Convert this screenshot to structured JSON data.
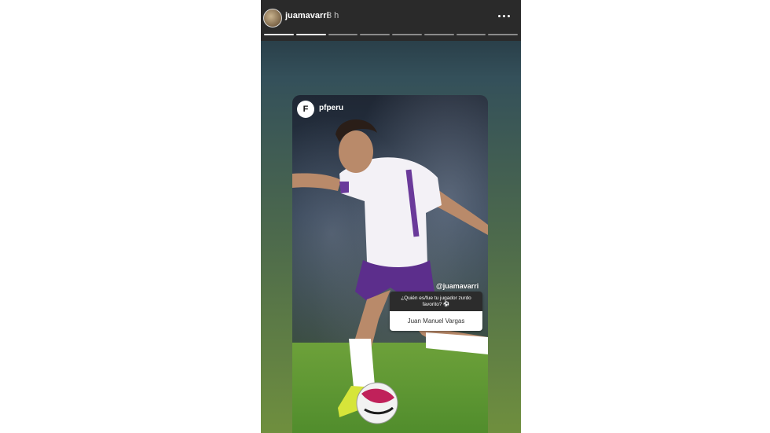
{
  "story": {
    "username": "juamavarri",
    "time": "3 h",
    "more_icon": "more-horizontal-icon",
    "progress_segments": 8,
    "progress_active": 1
  },
  "post": {
    "account": "pfperu",
    "logo_text": "F",
    "mention": "@juamavarri",
    "question": "¿Quién es/fue tu jugador zurdo favorito? ⚽",
    "answer": "Juan Manuel Vargas"
  }
}
